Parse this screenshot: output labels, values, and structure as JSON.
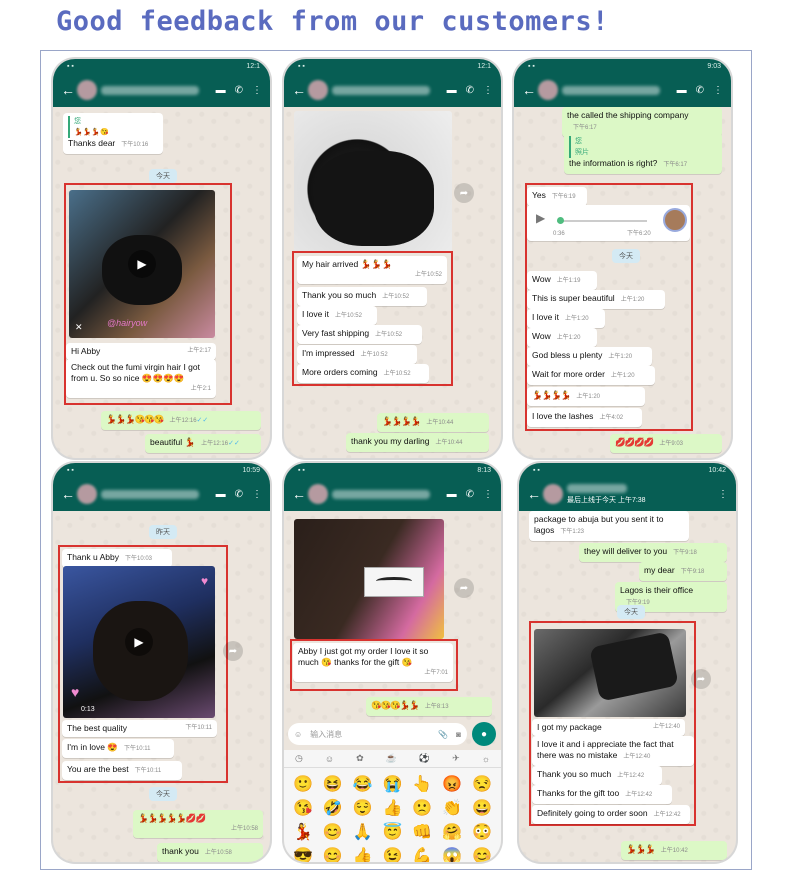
{
  "headline": "Good feedback from our customers!",
  "colors": {
    "header": "#075e54",
    "incoming": "#ffffff",
    "outgoing": "#dcf8c6",
    "highlight": "#d8332f",
    "title": "#5a6bbf"
  },
  "p1": {
    "status_time": "12:1",
    "quote_name": "您",
    "quote_text": "💃💃💃😘",
    "m1": "Thanks dear",
    "m1_time": "下午10:16",
    "day": "今天",
    "watermark": "@hairyow",
    "m2": "Hi Abby",
    "m2_time": "上午2:17",
    "m3": "Check out the fumi virgin hair I got from u. So so nice 😍😍😍😍",
    "m3_time": "上午2:1",
    "m4": "💃💃💃😘😘😘",
    "m4_time": "上午12:16",
    "m5": "beautiful 💃",
    "m5_time": "上午12:16"
  },
  "p2": {
    "status_time": "12:1",
    "m1": "My hair arrived 💃💃💃",
    "m1_time": "上午10:52",
    "m2": "Thank you so much",
    "m2_time": "上午10:52",
    "m3": "I love it",
    "m3_time": "上午10:52",
    "m4": "Very fast shipping",
    "m4_time": "上午10:52",
    "m5": "I'm impressed",
    "m5_time": "上午10:52",
    "m6": "More orders coming",
    "m6_time": "上午10:52",
    "m7": "💃💃💃💃",
    "m7_time": "上午10:44",
    "m8": "thank you my darling",
    "m8_time": "上午10:44"
  },
  "p3": {
    "status_time": "9:03",
    "m0": "the called the shipping company",
    "m0_time": "下午6:17",
    "quote_name": "您",
    "quote_text": "照片",
    "m1": "the information is right?",
    "m1_time": "下午6:17",
    "m2": "Yes",
    "m2_time": "下午6:19",
    "voice_dur": "0:36",
    "voice_time": "下午6:20",
    "day": "今天",
    "m3": "Wow",
    "m3_time": "上午1:19",
    "m4": "This is super beautiful",
    "m4_time": "上午1:20",
    "m5": "I love it",
    "m5_time": "上午1:20",
    "m6": "Wow",
    "m6_time": "上午1:20",
    "m7": "God bless u plenty",
    "m7_time": "上午1:20",
    "m8": "Wait for more order",
    "m8_time": "上午1:20",
    "m9": "💃💃💃💃",
    "m9_time": "上午1:20",
    "m10": "I love the lashes",
    "m10_time": "上午4:02",
    "m11": "💋💋💋💋",
    "m11_time": "上午9:03"
  },
  "p4": {
    "status_time": "10:59",
    "day1": "昨天",
    "m1": "Thank u Abby",
    "m1_time": "下午10:03",
    "video_dur": "0:13",
    "m2": "The best quality",
    "m2_time": "下午10:11",
    "m3": "I'm in love 😍",
    "m3_time": "下午10:11",
    "m4": "You are the best",
    "m4_time": "下午10:11",
    "day2": "今天",
    "m5": "💃💃💃💃💃💋💋",
    "m5_time": "上午10:58",
    "m6": "thank you",
    "m6_time": "上午10:58"
  },
  "p5": {
    "status_time": "8:13",
    "m1": "Abby I just got my order I love it so much 😘 thanks for the gift 😘",
    "m1_time": "上午7:01",
    "m2": "😘😘😘💃💃",
    "m2_time": "上午8:13",
    "input_placeholder": "输入消息",
    "emojis": [
      "🙂",
      "😆",
      "😂",
      "😭",
      "👆",
      "😡",
      "😒",
      "😘",
      "🤣",
      "😌",
      "👍",
      "🙁",
      "👏",
      "😀",
      "💃",
      "😊",
      "🙏",
      "😇",
      "👊",
      "🤗",
      "😳",
      "😎",
      "😊",
      "👍",
      "😉",
      "💪",
      "😱",
      "😊",
      "😎",
      "😀",
      "😁",
      "😊",
      "😉",
      "😂",
      "😀"
    ]
  },
  "p6": {
    "status_time": "10:42",
    "last_seen": "最后上线于今天 上午7:38",
    "m0": "package to abuja but you sent it to lagos",
    "m0_time": "下午1:23",
    "m1": "they will deliver to you",
    "m1_time": "下午9:18",
    "m2": "my dear",
    "m2_time": "下午9:18",
    "m3": "Lagos is their office",
    "m3_time": "下午9:19",
    "day": "今天",
    "m4": "I got my package",
    "m4_time": "上午12:40",
    "m5": "I love it and i appreciate the fact that there was no mistake",
    "m5_time": "上午12:40",
    "m6": "Thank you so much",
    "m6_time": "上午12:42",
    "m7": "Thanks for the gift too",
    "m7_time": "上午12:42",
    "m8": "Definitely going to order soon",
    "m8_time": "上午12:42",
    "m9": "💃💃💃",
    "m9_time": "上午10:42"
  }
}
